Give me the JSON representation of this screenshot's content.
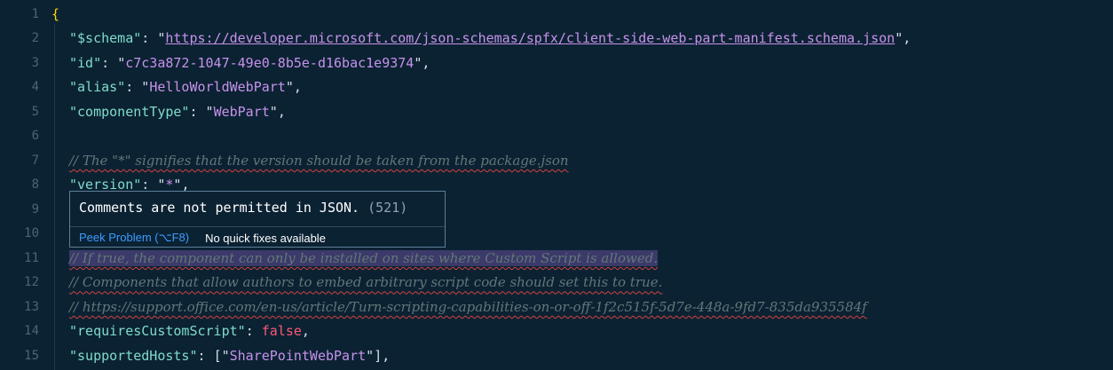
{
  "editor": {
    "line_numbers": [
      "1",
      "2",
      "3",
      "4",
      "5",
      "6",
      "7",
      "8",
      "9",
      "10",
      "11",
      "12",
      "13",
      "14",
      "15"
    ],
    "line1": {
      "brace": "{"
    },
    "line2": {
      "key": "\"$schema\"",
      "colon": ": ",
      "q1": "\"",
      "url": "https://developer.microsoft.com/json-schemas/spfx/client-side-web-part-manifest.schema.json",
      "q2": "\"",
      "comma": ","
    },
    "line3": {
      "key": "\"id\"",
      "colon": ": ",
      "q1": "\"",
      "value": "c7c3a872-1047-49e0-8b5e-d16bac1e9374",
      "q2": "\"",
      "comma": ","
    },
    "line4": {
      "key": "\"alias\"",
      "colon": ": ",
      "q1": "\"",
      "value": "HelloWorldWebPart",
      "q2": "\"",
      "comma": ","
    },
    "line5": {
      "key": "\"componentType\"",
      "colon": ": ",
      "q1": "\"",
      "value": "WebPart",
      "q2": "\"",
      "comma": ","
    },
    "line7": {
      "comment": "// The \"*\" signifies that the version should be taken from the package.json"
    },
    "line8": {
      "key": "\"version\"",
      "colon": ": ",
      "q1": "\"",
      "value": "*",
      "q2": "\"",
      "comma": ","
    },
    "line11": {
      "comment": "// If true, the component can only be installed on sites where Custom Script is allowed."
    },
    "line12": {
      "comment": "// Components that allow authors to embed arbitrary script code should set this to true."
    },
    "line13": {
      "comment": "// https://support.office.com/en-us/article/Turn-scripting-capabilities-on-or-off-1f2c515f-5d7e-448a-9fd7-835da935584f"
    },
    "line14": {
      "key": "\"requiresCustomScript\"",
      "colon": ": ",
      "value": "false",
      "comma": ","
    },
    "line15": {
      "key": "\"supportedHosts\"",
      "colon": ": ",
      "open": "[",
      "q1": "\"",
      "value": "SharePointWebPart",
      "q2": "\"",
      "close": "]",
      "comma": ","
    }
  },
  "hover": {
    "message": "Comments are not permitted in JSON.",
    "code": "(521)",
    "peek_label": "Peek Problem (⌥F8)",
    "no_fixes_label": "No quick fixes available"
  },
  "colors": {
    "background": "#0b2233",
    "key": "#7fdbca",
    "string": "#c792ea",
    "boolean": "#ff5874",
    "comment": "#637777",
    "brace": "#ffd700",
    "error_squiggle": "#d3423e",
    "link": "#3b9cff",
    "selection": "#3b3a6a"
  }
}
